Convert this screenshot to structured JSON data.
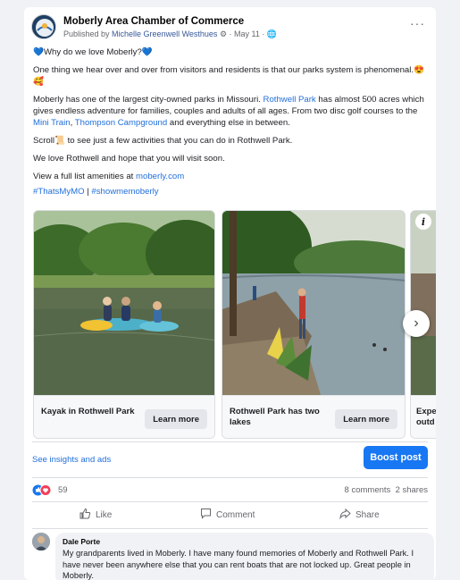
{
  "post": {
    "page_name": "Moberly Area Chamber of Commerce",
    "published_by_prefix": "Published by ",
    "author": "Michelle Greenwell Westhues",
    "date": " · May 11 · ",
    "more_icon": "more-options-icon",
    "globe_icon": "globe-icon",
    "gear_icon": "gear-icon"
  },
  "body": {
    "line1": "Why do we love Moberly?",
    "line2": "One thing we hear over and over from visitors and residents is that our parks system is phenomenal.",
    "p3_a": "Moberly has one of the largest city-owned parks in Missouri. ",
    "p3_link1": "Rothwell Park",
    "p3_b": " has almost 500 acres which gives endless adventure for families, couples and adults of all ages. From two disc golf courses to the ",
    "p3_link2": "Mini Train",
    "p3_c": ", ",
    "p3_link3": "Thompson Campground",
    "p3_d": " and everything else in between.",
    "p4_a": "Scroll",
    "p4_b": " to see just a few activities that you can do in Rothwell Park.",
    "p5": "We love Rothwell and hope that you will visit soon.",
    "p6_a": "View a full list amenities at ",
    "p6_link": "moberly.com",
    "hashtag1": "#ThatsMyMO",
    "hashtag_sep": " | ",
    "hashtag2": "#showmemoberly"
  },
  "carousel": {
    "items": [
      {
        "title": "Kayak in Rothwell Park",
        "button": "Learn more"
      },
      {
        "title": "Rothwell Park has two lakes",
        "button": "Learn more"
      },
      {
        "title": "Expe outd",
        "button": ""
      }
    ],
    "info_label": "i",
    "next_label": "›"
  },
  "insights": {
    "link": "See insights and ads",
    "boost_button": "Boost post"
  },
  "stats": {
    "reactions": "59",
    "comments": "8 comments",
    "shares": "2 shares"
  },
  "actions": {
    "like": "Like",
    "comment": "Comment",
    "share": "Share"
  },
  "comment": {
    "name": "Dale Porte",
    "text": "My grandparents lived in Moberly. I have many found memories of Moberly and Rothwell Park. I have never been anywhere else that you can rent boats that are not locked up. Great people in Moberly."
  },
  "colors": {
    "accent": "#1877f2",
    "link": "#216fdb",
    "muted": "#65676b"
  }
}
